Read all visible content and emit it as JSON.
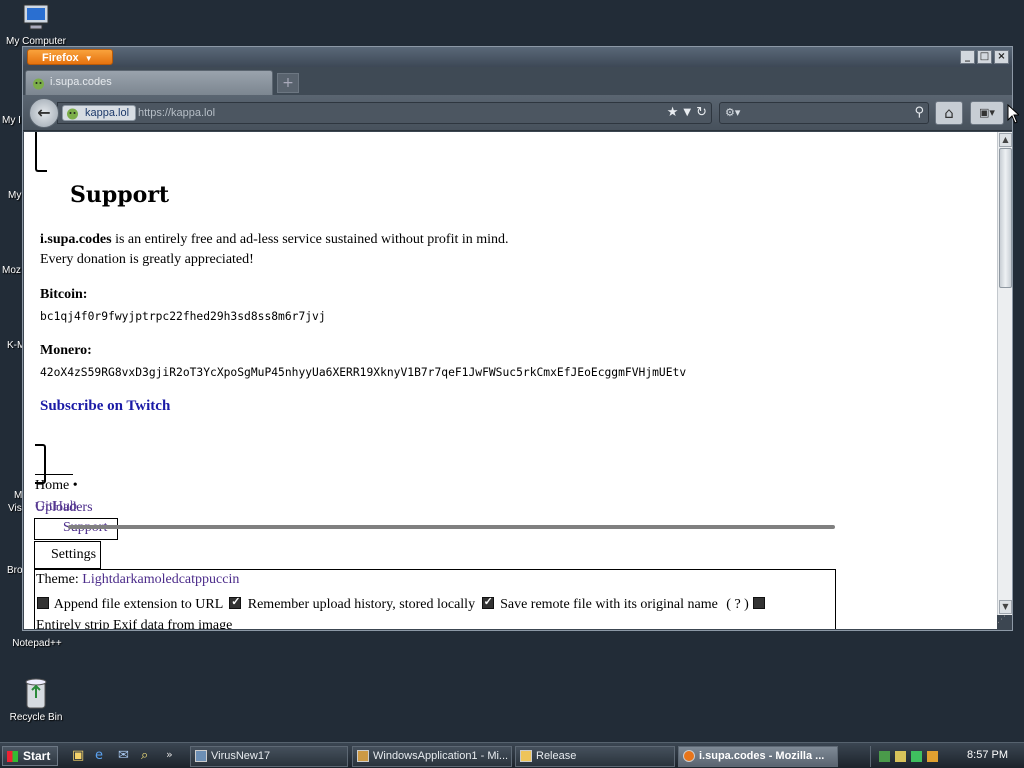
{
  "desktop": {
    "icons": [
      {
        "label": "My Computer"
      },
      {
        "label": "Notepad++"
      },
      {
        "label": "Recycle Bin"
      }
    ],
    "partial_labels": [
      "My I",
      "My",
      "Moz",
      "K-M",
      "M",
      "Vis",
      "Bro"
    ]
  },
  "browser": {
    "menu_button": "Firefox",
    "window_controls": [
      "_",
      "□",
      "×"
    ],
    "tab": {
      "title": "i.supa.codes"
    },
    "identity_label": "kappa.lol",
    "url": "https://kappa.lol",
    "search_engine_placeholder": ""
  },
  "page": {
    "title": "Support",
    "intro_bold": "i.supa.codes",
    "intro_rest": " is an entirely free and ad-less service sustained without profit in mind.",
    "intro_line2": "Every donation is greatly appreciated!",
    "bitcoin_label": "Bitcoin:",
    "bitcoin_address": "bc1qj4f0r9fwyjptrpc22fhed29h3sd8ss8m6r7jvj",
    "monero_label": "Monero:",
    "monero_address": "42oX4zS59RG8vxD3gjiR2oT3YcXpoSgMuP45nhyyUa6XERR19XknyV1B7r7qeF1JwFWSuc5rkCmxEfJEoEcggmFVHjmUEtv",
    "twitch_link": "Subscribe on Twitch",
    "footer": {
      "home": "Home",
      "bullet": "•",
      "uploaders": "Uploaders",
      "github": "GitHub",
      "support": "Support",
      "settings": "Settings"
    },
    "settings": {
      "theme_label": "Theme:",
      "themes": [
        "Light",
        "dark",
        "amoled",
        "catppuccin"
      ],
      "append_ext": "Append file extension to URL",
      "remember_history": "Remember upload history, stored locally",
      "save_remote": "Save remote file with its original name",
      "help": "( ? )",
      "strip_exif": "Entirely strip Exif data from image"
    }
  },
  "taskbar": {
    "start_label": "Start",
    "tasks": [
      {
        "label": "VirusNew17"
      },
      {
        "label": "WindowsApplication1 - Mi..."
      },
      {
        "label": "Release"
      },
      {
        "label": "i.supa.codes - Mozilla ..."
      }
    ],
    "clock": "8:57 PM"
  }
}
